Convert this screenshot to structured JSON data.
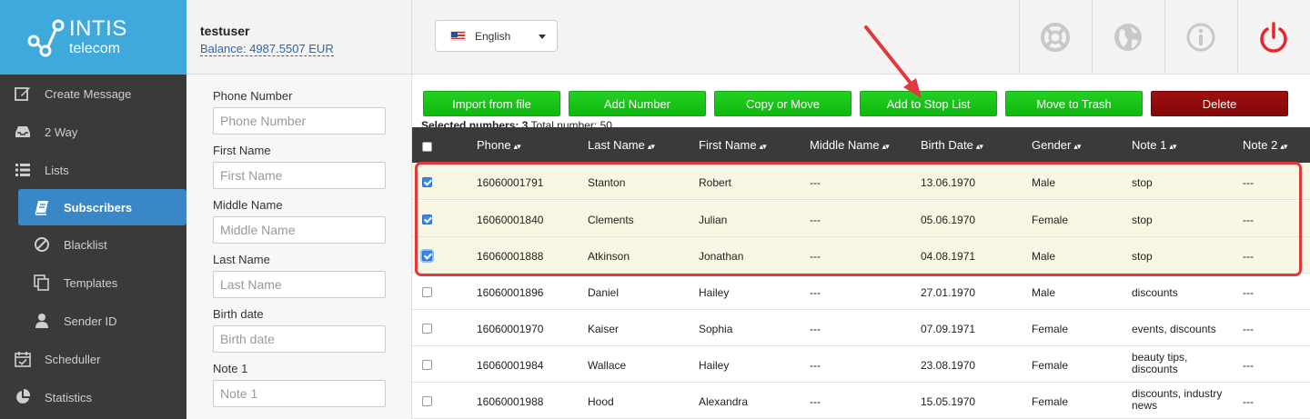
{
  "brand": {
    "line1": "INTIS",
    "line2": "telecom"
  },
  "user": {
    "name": "testuser",
    "balance": "Balance: 4987.5507 EUR"
  },
  "language": {
    "selected": "English"
  },
  "header_icons": [
    "lifebuoy-icon",
    "globe-icon",
    "info-icon",
    "power-icon"
  ],
  "sidebar": {
    "items": [
      {
        "label": "Create Message",
        "icon": "edit-icon"
      },
      {
        "label": "2 Way",
        "icon": "inbox-icon"
      },
      {
        "label": "Lists",
        "icon": "list-icon"
      },
      {
        "label": "Subscribers",
        "icon": "book-icon"
      },
      {
        "label": "Blacklist",
        "icon": "ban-icon"
      },
      {
        "label": "Templates",
        "icon": "copy-icon"
      },
      {
        "label": "Sender ID",
        "icon": "user-icon"
      },
      {
        "label": "Scheduller",
        "icon": "calendar-icon"
      },
      {
        "label": "Statistics",
        "icon": "pie-chart-icon"
      }
    ]
  },
  "filters": [
    {
      "label": "Phone Number",
      "placeholder": "Phone Number"
    },
    {
      "label": "First Name",
      "placeholder": "First Name"
    },
    {
      "label": "Middle Name",
      "placeholder": "Middle Name"
    },
    {
      "label": "Last Name",
      "placeholder": "Last Name"
    },
    {
      "label": "Birth date",
      "placeholder": "Birth date"
    },
    {
      "label": "Note 1",
      "placeholder": "Note 1"
    }
  ],
  "toolbar": {
    "import": "Import from file",
    "add": "Add Number",
    "copy_move": "Copy or Move",
    "stop_list": "Add to Stop List",
    "trash": "Move to Trash",
    "delete": "Delete"
  },
  "selection": {
    "label": "Selected numbers:",
    "count": "3",
    "total_label": "Total number:",
    "total": "50"
  },
  "table": {
    "columns": [
      "Phone",
      "Last Name",
      "First Name",
      "Middle Name",
      "Birth Date",
      "Gender",
      "Note 1",
      "Note 2"
    ],
    "rows": [
      {
        "checked": true,
        "phone": "16060001791",
        "last": "Stanton",
        "first": "Robert",
        "middle": "---",
        "birth": "13.06.1970",
        "gender": "Male",
        "note1": "stop",
        "note2": "---"
      },
      {
        "checked": true,
        "phone": "16060001840",
        "last": "Clements",
        "first": "Julian",
        "middle": "---",
        "birth": "05.06.1970",
        "gender": "Female",
        "note1": "stop",
        "note2": "---"
      },
      {
        "checked": true,
        "phone": "16060001888",
        "last": "Atkinson",
        "first": "Jonathan",
        "middle": "---",
        "birth": "04.08.1971",
        "gender": "Male",
        "note1": "stop",
        "note2": "---"
      },
      {
        "checked": false,
        "phone": "16060001896",
        "last": "Daniel",
        "first": "Hailey",
        "middle": "---",
        "birth": "27.01.1970",
        "gender": "Male",
        "note1": "discounts",
        "note2": "---"
      },
      {
        "checked": false,
        "phone": "16060001970",
        "last": "Kaiser",
        "first": "Sophia",
        "middle": "---",
        "birth": "07.09.1971",
        "gender": "Female",
        "note1": "events, discounts",
        "note2": "---"
      },
      {
        "checked": false,
        "phone": "16060001984",
        "last": "Wallace",
        "first": "Hailey",
        "middle": "---",
        "birth": "23.08.1970",
        "gender": "Female",
        "note1": "beauty tips, discounts",
        "note2": "---"
      },
      {
        "checked": false,
        "phone": "16060001988",
        "last": "Hood",
        "first": "Alexandra",
        "middle": "---",
        "birth": "15.05.1970",
        "gender": "Female",
        "note1": "discounts, industry news",
        "note2": "---"
      }
    ]
  },
  "colors": {
    "brand": "#3fa9dc",
    "sidebar": "#3a3a3a",
    "active": "#3a87c8",
    "green": "#14c314",
    "danger": "#8e0b0b",
    "annotation": "#e0393d"
  }
}
